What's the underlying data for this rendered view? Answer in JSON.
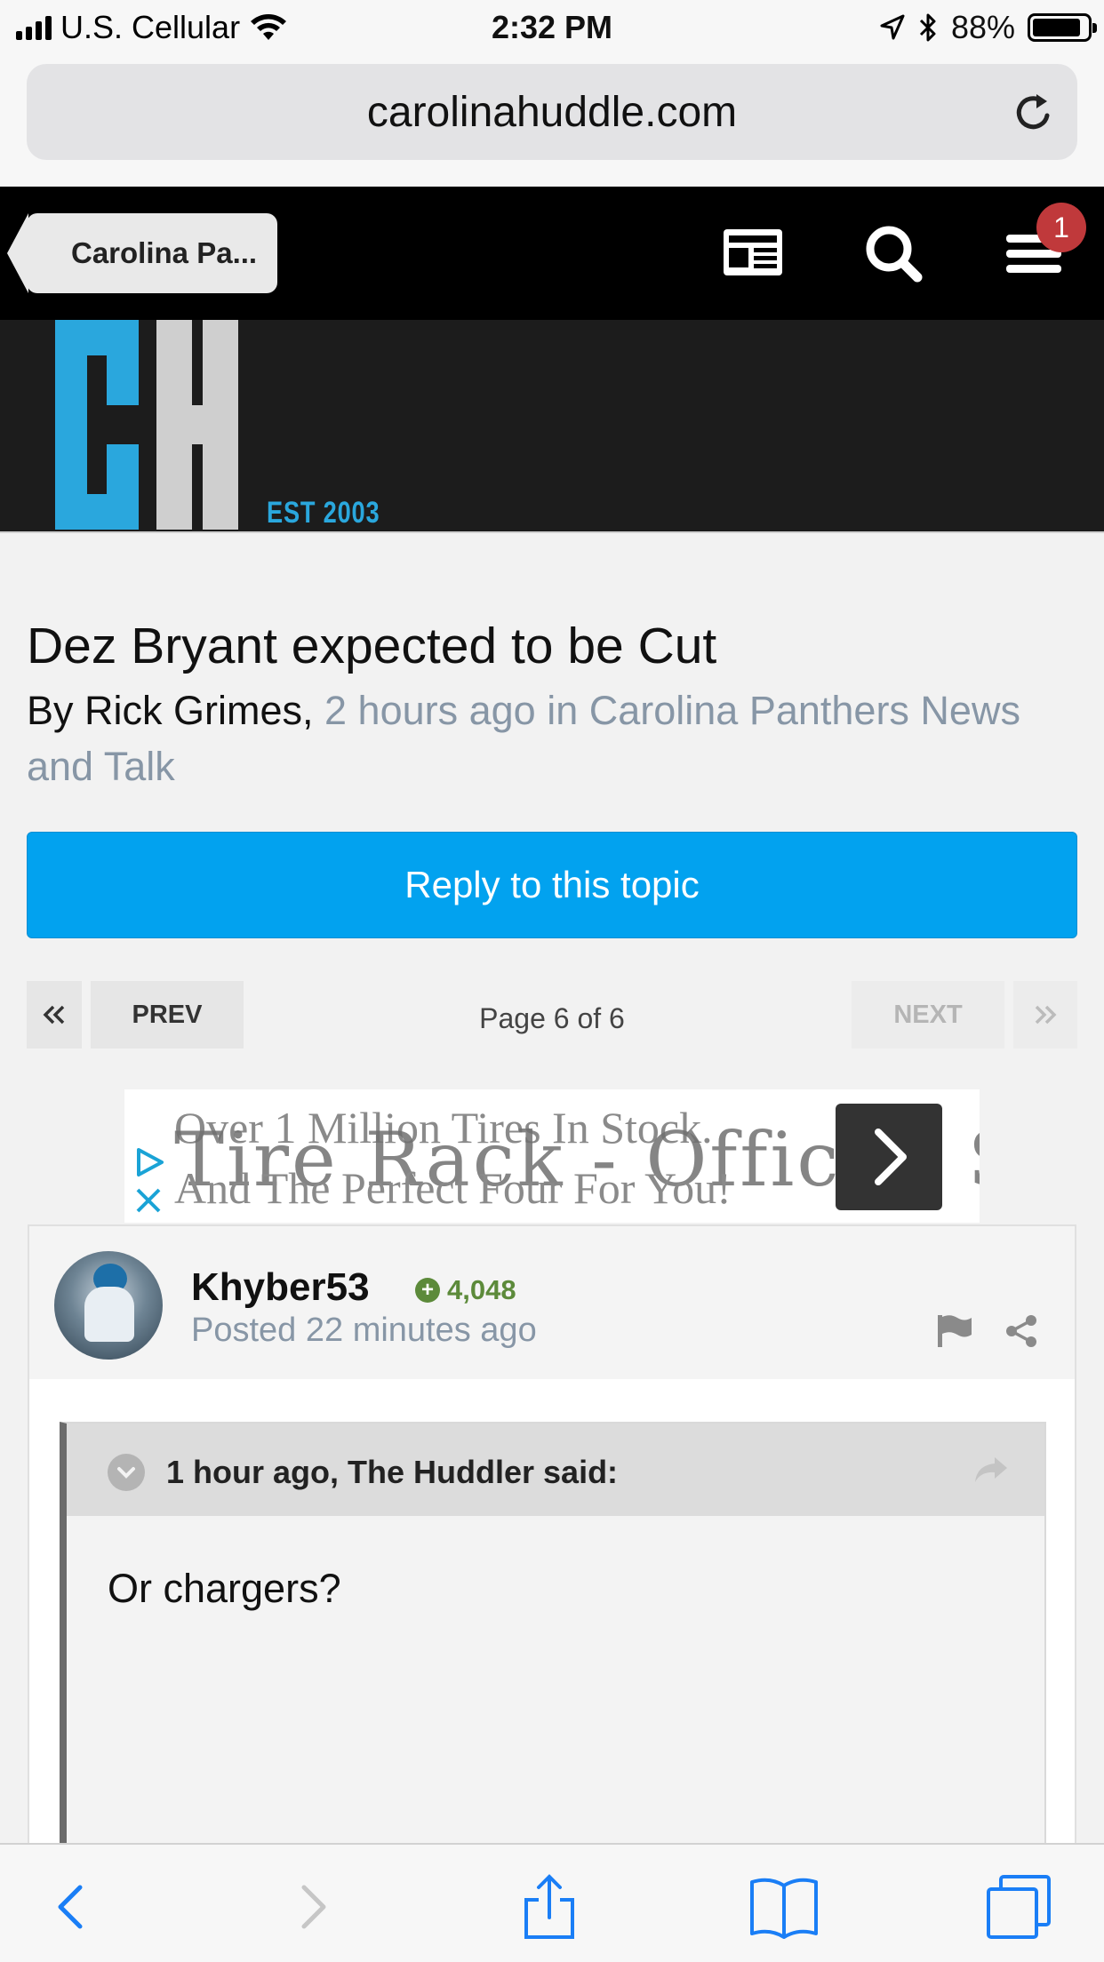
{
  "status_bar": {
    "carrier": "U.S. Cellular",
    "time": "2:32 PM",
    "battery": "88%"
  },
  "browser": {
    "url": "carolinahuddle.com"
  },
  "site_nav": {
    "back_label": "Carolina Pa...",
    "notification_count": "1"
  },
  "banner": {
    "logo_letters": "CH",
    "logo_tagline": "EST 2003"
  },
  "topic": {
    "title": "Dez Bryant expected to be Cut",
    "by_prefix": "By Rick Grimes,",
    "meta_rest": " 2 hours ago in Carolina Panthers News and Talk"
  },
  "reply_button": "Reply to this topic",
  "pagination": {
    "prev": "PREV",
    "next": "NEXT",
    "info": "Page 6 of 6"
  },
  "ad": {
    "line1": "Over 1 Million Tires In Stock.",
    "headline": "Tire Rack - Official S",
    "line2": "And The Perfect Four For You!"
  },
  "post": {
    "author": "Khyber53",
    "reputation": "4,048",
    "posted": "Posted 22 minutes ago",
    "quote_cite": "1 hour ago, The Huddler said:",
    "quote_text": "Or chargers?"
  },
  "colors": {
    "accent": "#02a2ef",
    "badge": "#c0393b",
    "logo_blue": "#2aa7dd",
    "rep_green": "#5c8a3a"
  }
}
